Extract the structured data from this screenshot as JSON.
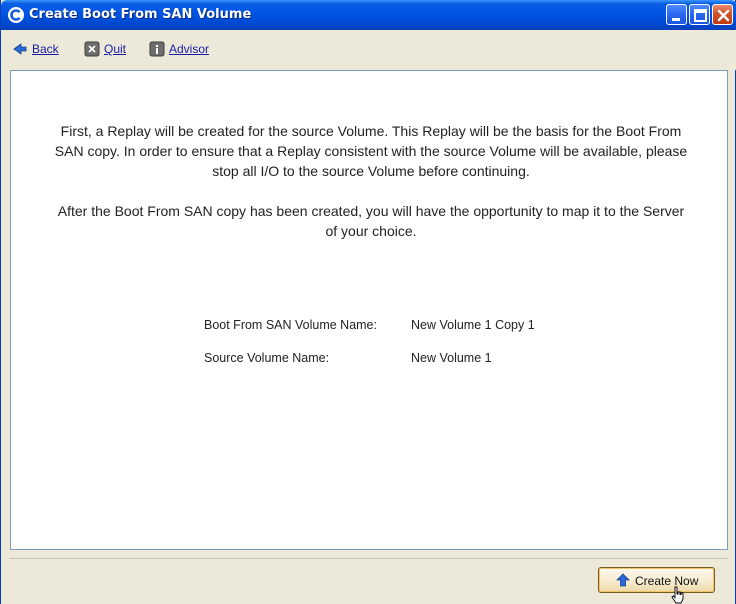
{
  "window": {
    "title": "Create Boot From SAN Volume",
    "icon": "app-circle-icon"
  },
  "toolbar": {
    "back_label": "Back",
    "quit_label": "Quit",
    "advisor_label": "Advisor"
  },
  "message": {
    "paragraph1": "First, a Replay will be created for the source Volume. This Replay will be the basis for the Boot From SAN copy. In order to ensure that a Replay consistent with the source Volume will be available, please stop all I/O to the source Volume before continuing.",
    "paragraph2": "After the Boot From SAN copy has been created, you will have the opportunity to map it to the Server of your choice."
  },
  "details": [
    {
      "label": "Boot From SAN Volume Name:",
      "value": "New Volume 1 Copy 1"
    },
    {
      "label": "Source Volume Name:",
      "value": "New Volume 1"
    }
  ],
  "footer": {
    "create_now_label": "Create Now"
  },
  "colors": {
    "titlebar": "#0054e3",
    "link": "#1a1aa6",
    "frame": "#ece9d8"
  }
}
